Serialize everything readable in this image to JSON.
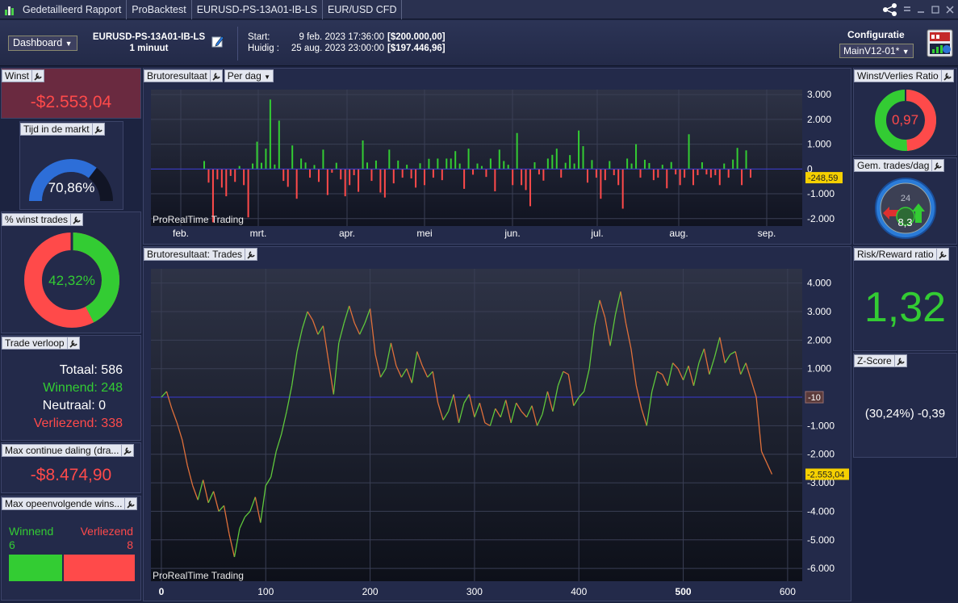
{
  "titlebar": {
    "tabs": [
      "Gedetailleerd Rapport",
      "ProBacktest",
      "EURUSD-PS-13A01-IB-LS",
      "EUR/USD CFD"
    ]
  },
  "header": {
    "dashboard_label": "Dashboard",
    "strategy_name": "EURUSD-PS-13A01-IB-LS",
    "timeframe": "1 minuut",
    "start_label": "Start:",
    "start_date": "9 feb. 2023 17:36:00",
    "start_amount": "[$200.000,00]",
    "current_label": "Huidig :",
    "current_date": "25 aug. 2023 23:00:00",
    "current_amount": "[$197.446,96]",
    "config_label": "Configuratie",
    "config_value": "MainV12-01*"
  },
  "left": {
    "winst": {
      "title": "Winst",
      "value": "-$2.553,04"
    },
    "tijd": {
      "title": "Tijd in de markt",
      "value": "70,86%",
      "fraction": 0.7086
    },
    "pct_winst": {
      "title": "% winst trades",
      "value": "42,32%",
      "fraction": 0.4232
    },
    "verloop": {
      "title": "Trade verloop",
      "totaal": "Totaal: 586",
      "winnend": "Winnend: 248",
      "neutraal": "Neutraal: 0",
      "verliezend": "Verliezend: 338"
    },
    "maxdaling": {
      "title": "Max continue daling (dra...",
      "value": "-$8.474,90"
    },
    "maxopeen": {
      "title": "Max opeenvolgende wins...",
      "winnend_label": "Winnend",
      "winnend_value": "6",
      "verliezend_label": "Verliezend",
      "verliezend_value": "8"
    }
  },
  "right": {
    "wv": {
      "title": "Winst/Verlies Ratio",
      "value": "0,97",
      "fraction": 0.49
    },
    "gem": {
      "title": "Gem. trades/dag",
      "value": "8,3",
      "dial_label": "24"
    },
    "rr": {
      "title": "Risk/Reward ratio",
      "value": "1,32"
    },
    "z": {
      "title": "Z-Score",
      "value": "(30,24%) -0,39"
    }
  },
  "colors": {
    "green": "#33cc33",
    "red": "#ff4a4a",
    "blue_line": "#3a3ad0",
    "price_tag": "#f5d000",
    "bg_panel": "#232a4a"
  },
  "charts": {
    "daily": {
      "title": "Brutoresultaat",
      "dropdown": "Per dag",
      "watermark": "ProRealTime Trading",
      "last_value_label": "-248,59"
    },
    "trades": {
      "title": "Brutoresultaat: Trades",
      "watermark": "ProRealTime Trading",
      "last_value_label": "-2.553,04",
      "zero_tag": "-10"
    }
  },
  "chart_data": [
    {
      "type": "bar",
      "title": "Brutoresultaat",
      "x_labels": [
        "feb.",
        "mrt.",
        "apr.",
        "mei",
        "jun.",
        "jul.",
        "aug.",
        "sep."
      ],
      "y_ticks": [
        "3.000",
        "2.000",
        "1.000",
        "0",
        "-1.000",
        "-2.000"
      ],
      "ylim": [
        -2300,
        3200
      ],
      "values": [
        320,
        -550,
        -2150,
        -420,
        -750,
        -1100,
        -280,
        -520,
        120,
        -650,
        -1950,
        220,
        1100,
        250,
        820,
        2800,
        180,
        1950,
        -480,
        -720,
        950,
        -1200,
        420,
        260,
        -350,
        160,
        -520,
        780,
        -1050,
        -150,
        250,
        -420,
        -1100,
        -650,
        -250,
        -920,
        1150,
        260,
        -480,
        340,
        -950,
        -1150,
        780,
        -580,
        340,
        -350,
        170,
        -380,
        -750,
        230,
        -650,
        410,
        -350,
        420,
        -450,
        420,
        420,
        720,
        220,
        -800,
        820,
        -230,
        220,
        120,
        -320,
        420,
        -900,
        780,
        320,
        170,
        -650,
        1450,
        -650,
        -850,
        -1500,
        270,
        -220,
        -470,
        420,
        570,
        820,
        -350,
        250,
        560,
        220,
        1550,
        920,
        -550,
        360,
        -350,
        -1200,
        -450,
        320,
        -250,
        -650,
        -1600,
        420,
        220,
        1000,
        -350,
        370,
        240,
        -450,
        -350,
        170,
        -780,
        280,
        -220,
        -650,
        -350,
        1400,
        -650,
        -250,
        270,
        -220,
        -350,
        -250,
        -650,
        220,
        -350,
        380,
        850,
        -650,
        750,
        -350
      ]
    },
    {
      "type": "line",
      "title": "Brutoresultaat: Trades",
      "x_ticks": [
        0,
        100,
        200,
        300,
        400,
        500,
        600
      ],
      "xlim": [
        -10,
        614
      ],
      "y_ticks": [
        "4.000",
        "3.000",
        "2.000",
        "1.000",
        "0",
        "-1.000",
        "-2.000",
        "-3.000",
        "-4.000",
        "-5.000",
        "-6.000"
      ],
      "ylim": [
        -6450,
        4500
      ],
      "series": [
        {
          "points": [
            [
              0,
              0
            ],
            [
              5,
              200
            ],
            [
              10,
              -400
            ],
            [
              15,
              -900
            ],
            [
              20,
              -1500
            ],
            [
              25,
              -2400
            ],
            [
              30,
              -3100
            ],
            [
              35,
              -3600
            ],
            [
              40,
              -2900
            ],
            [
              45,
              -3700
            ],
            [
              50,
              -3300
            ],
            [
              55,
              -4000
            ],
            [
              60,
              -3800
            ],
            [
              65,
              -4800
            ],
            [
              70,
              -5600
            ],
            [
              75,
              -4600
            ],
            [
              80,
              -4200
            ],
            [
              85,
              -4000
            ],
            [
              90,
              -3500
            ],
            [
              95,
              -4400
            ],
            [
              100,
              -3100
            ],
            [
              105,
              -2800
            ],
            [
              110,
              -1900
            ],
            [
              115,
              -1300
            ],
            [
              120,
              -500
            ],
            [
              125,
              400
            ],
            [
              130,
              1600
            ],
            [
              135,
              2400
            ],
            [
              140,
              3000
            ],
            [
              145,
              2700
            ],
            [
              150,
              2200
            ],
            [
              155,
              2500
            ],
            [
              160,
              1300
            ],
            [
              165,
              100
            ],
            [
              170,
              1900
            ],
            [
              175,
              2600
            ],
            [
              180,
              3200
            ],
            [
              185,
              2600
            ],
            [
              190,
              2200
            ],
            [
              195,
              2600
            ],
            [
              200,
              3100
            ],
            [
              205,
              1500
            ],
            [
              210,
              700
            ],
            [
              215,
              1000
            ],
            [
              220,
              1900
            ],
            [
              225,
              1100
            ],
            [
              230,
              700
            ],
            [
              235,
              1000
            ],
            [
              240,
              500
            ],
            [
              245,
              1600
            ],
            [
              250,
              1100
            ],
            [
              255,
              700
            ],
            [
              260,
              900
            ],
            [
              265,
              -200
            ],
            [
              270,
              -800
            ],
            [
              275,
              -500
            ],
            [
              280,
              100
            ],
            [
              285,
              -900
            ],
            [
              290,
              -200
            ],
            [
              295,
              100
            ],
            [
              300,
              -700
            ],
            [
              305,
              -200
            ],
            [
              310,
              -900
            ],
            [
              315,
              -1000
            ],
            [
              320,
              -400
            ],
            [
              325,
              -700
            ],
            [
              330,
              -100
            ],
            [
              335,
              -900
            ],
            [
              340,
              -200
            ],
            [
              345,
              -500
            ],
            [
              350,
              -700
            ],
            [
              355,
              -300
            ],
            [
              360,
              -1000
            ],
            [
              365,
              -600
            ],
            [
              370,
              200
            ],
            [
              375,
              -500
            ],
            [
              380,
              400
            ],
            [
              385,
              900
            ],
            [
              390,
              800
            ],
            [
              395,
              -300
            ],
            [
              400,
              0
            ],
            [
              405,
              200
            ],
            [
              410,
              1000
            ],
            [
              415,
              2500
            ],
            [
              420,
              3400
            ],
            [
              425,
              2800
            ],
            [
              430,
              1800
            ],
            [
              435,
              2900
            ],
            [
              440,
              3700
            ],
            [
              445,
              2600
            ],
            [
              450,
              1700
            ],
            [
              455,
              400
            ],
            [
              460,
              -400
            ],
            [
              465,
              -1000
            ],
            [
              470,
              200
            ],
            [
              475,
              900
            ],
            [
              480,
              800
            ],
            [
              485,
              400
            ],
            [
              490,
              1200
            ],
            [
              495,
              1000
            ],
            [
              500,
              600
            ],
            [
              505,
              1100
            ],
            [
              510,
              400
            ],
            [
              515,
              1200
            ],
            [
              520,
              1700
            ],
            [
              525,
              800
            ],
            [
              530,
              1400
            ],
            [
              535,
              2100
            ],
            [
              540,
              1200
            ],
            [
              545,
              1500
            ],
            [
              550,
              1600
            ],
            [
              555,
              800
            ],
            [
              560,
              1200
            ],
            [
              565,
              600
            ],
            [
              570,
              0
            ],
            [
              575,
              -1900
            ],
            [
              580,
              -2300
            ],
            [
              585,
              -2700
            ]
          ]
        }
      ]
    }
  ]
}
